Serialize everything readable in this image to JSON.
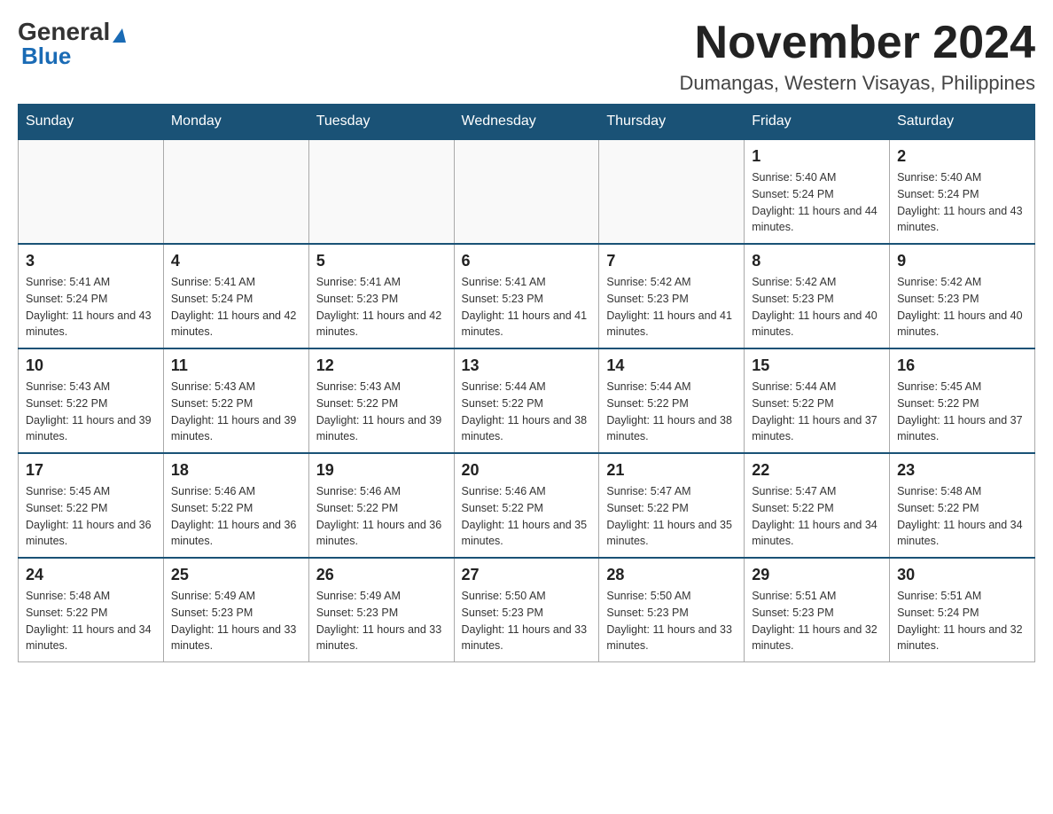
{
  "logo": {
    "general_text": "General",
    "blue_text": "Blue"
  },
  "header": {
    "month_year": "November 2024",
    "location": "Dumangas, Western Visayas, Philippines"
  },
  "weekdays": [
    "Sunday",
    "Monday",
    "Tuesday",
    "Wednesday",
    "Thursday",
    "Friday",
    "Saturday"
  ],
  "weeks": [
    [
      {
        "day": "",
        "sunrise": "",
        "sunset": "",
        "daylight": ""
      },
      {
        "day": "",
        "sunrise": "",
        "sunset": "",
        "daylight": ""
      },
      {
        "day": "",
        "sunrise": "",
        "sunset": "",
        "daylight": ""
      },
      {
        "day": "",
        "sunrise": "",
        "sunset": "",
        "daylight": ""
      },
      {
        "day": "",
        "sunrise": "",
        "sunset": "",
        "daylight": ""
      },
      {
        "day": "1",
        "sunrise": "Sunrise: 5:40 AM",
        "sunset": "Sunset: 5:24 PM",
        "daylight": "Daylight: 11 hours and 44 minutes."
      },
      {
        "day": "2",
        "sunrise": "Sunrise: 5:40 AM",
        "sunset": "Sunset: 5:24 PM",
        "daylight": "Daylight: 11 hours and 43 minutes."
      }
    ],
    [
      {
        "day": "3",
        "sunrise": "Sunrise: 5:41 AM",
        "sunset": "Sunset: 5:24 PM",
        "daylight": "Daylight: 11 hours and 43 minutes."
      },
      {
        "day": "4",
        "sunrise": "Sunrise: 5:41 AM",
        "sunset": "Sunset: 5:24 PM",
        "daylight": "Daylight: 11 hours and 42 minutes."
      },
      {
        "day": "5",
        "sunrise": "Sunrise: 5:41 AM",
        "sunset": "Sunset: 5:23 PM",
        "daylight": "Daylight: 11 hours and 42 minutes."
      },
      {
        "day": "6",
        "sunrise": "Sunrise: 5:41 AM",
        "sunset": "Sunset: 5:23 PM",
        "daylight": "Daylight: 11 hours and 41 minutes."
      },
      {
        "day": "7",
        "sunrise": "Sunrise: 5:42 AM",
        "sunset": "Sunset: 5:23 PM",
        "daylight": "Daylight: 11 hours and 41 minutes."
      },
      {
        "day": "8",
        "sunrise": "Sunrise: 5:42 AM",
        "sunset": "Sunset: 5:23 PM",
        "daylight": "Daylight: 11 hours and 40 minutes."
      },
      {
        "day": "9",
        "sunrise": "Sunrise: 5:42 AM",
        "sunset": "Sunset: 5:23 PM",
        "daylight": "Daylight: 11 hours and 40 minutes."
      }
    ],
    [
      {
        "day": "10",
        "sunrise": "Sunrise: 5:43 AM",
        "sunset": "Sunset: 5:22 PM",
        "daylight": "Daylight: 11 hours and 39 minutes."
      },
      {
        "day": "11",
        "sunrise": "Sunrise: 5:43 AM",
        "sunset": "Sunset: 5:22 PM",
        "daylight": "Daylight: 11 hours and 39 minutes."
      },
      {
        "day": "12",
        "sunrise": "Sunrise: 5:43 AM",
        "sunset": "Sunset: 5:22 PM",
        "daylight": "Daylight: 11 hours and 39 minutes."
      },
      {
        "day": "13",
        "sunrise": "Sunrise: 5:44 AM",
        "sunset": "Sunset: 5:22 PM",
        "daylight": "Daylight: 11 hours and 38 minutes."
      },
      {
        "day": "14",
        "sunrise": "Sunrise: 5:44 AM",
        "sunset": "Sunset: 5:22 PM",
        "daylight": "Daylight: 11 hours and 38 minutes."
      },
      {
        "day": "15",
        "sunrise": "Sunrise: 5:44 AM",
        "sunset": "Sunset: 5:22 PM",
        "daylight": "Daylight: 11 hours and 37 minutes."
      },
      {
        "day": "16",
        "sunrise": "Sunrise: 5:45 AM",
        "sunset": "Sunset: 5:22 PM",
        "daylight": "Daylight: 11 hours and 37 minutes."
      }
    ],
    [
      {
        "day": "17",
        "sunrise": "Sunrise: 5:45 AM",
        "sunset": "Sunset: 5:22 PM",
        "daylight": "Daylight: 11 hours and 36 minutes."
      },
      {
        "day": "18",
        "sunrise": "Sunrise: 5:46 AM",
        "sunset": "Sunset: 5:22 PM",
        "daylight": "Daylight: 11 hours and 36 minutes."
      },
      {
        "day": "19",
        "sunrise": "Sunrise: 5:46 AM",
        "sunset": "Sunset: 5:22 PM",
        "daylight": "Daylight: 11 hours and 36 minutes."
      },
      {
        "day": "20",
        "sunrise": "Sunrise: 5:46 AM",
        "sunset": "Sunset: 5:22 PM",
        "daylight": "Daylight: 11 hours and 35 minutes."
      },
      {
        "day": "21",
        "sunrise": "Sunrise: 5:47 AM",
        "sunset": "Sunset: 5:22 PM",
        "daylight": "Daylight: 11 hours and 35 minutes."
      },
      {
        "day": "22",
        "sunrise": "Sunrise: 5:47 AM",
        "sunset": "Sunset: 5:22 PM",
        "daylight": "Daylight: 11 hours and 34 minutes."
      },
      {
        "day": "23",
        "sunrise": "Sunrise: 5:48 AM",
        "sunset": "Sunset: 5:22 PM",
        "daylight": "Daylight: 11 hours and 34 minutes."
      }
    ],
    [
      {
        "day": "24",
        "sunrise": "Sunrise: 5:48 AM",
        "sunset": "Sunset: 5:22 PM",
        "daylight": "Daylight: 11 hours and 34 minutes."
      },
      {
        "day": "25",
        "sunrise": "Sunrise: 5:49 AM",
        "sunset": "Sunset: 5:23 PM",
        "daylight": "Daylight: 11 hours and 33 minutes."
      },
      {
        "day": "26",
        "sunrise": "Sunrise: 5:49 AM",
        "sunset": "Sunset: 5:23 PM",
        "daylight": "Daylight: 11 hours and 33 minutes."
      },
      {
        "day": "27",
        "sunrise": "Sunrise: 5:50 AM",
        "sunset": "Sunset: 5:23 PM",
        "daylight": "Daylight: 11 hours and 33 minutes."
      },
      {
        "day": "28",
        "sunrise": "Sunrise: 5:50 AM",
        "sunset": "Sunset: 5:23 PM",
        "daylight": "Daylight: 11 hours and 33 minutes."
      },
      {
        "day": "29",
        "sunrise": "Sunrise: 5:51 AM",
        "sunset": "Sunset: 5:23 PM",
        "daylight": "Daylight: 11 hours and 32 minutes."
      },
      {
        "day": "30",
        "sunrise": "Sunrise: 5:51 AM",
        "sunset": "Sunset: 5:24 PM",
        "daylight": "Daylight: 11 hours and 32 minutes."
      }
    ]
  ]
}
